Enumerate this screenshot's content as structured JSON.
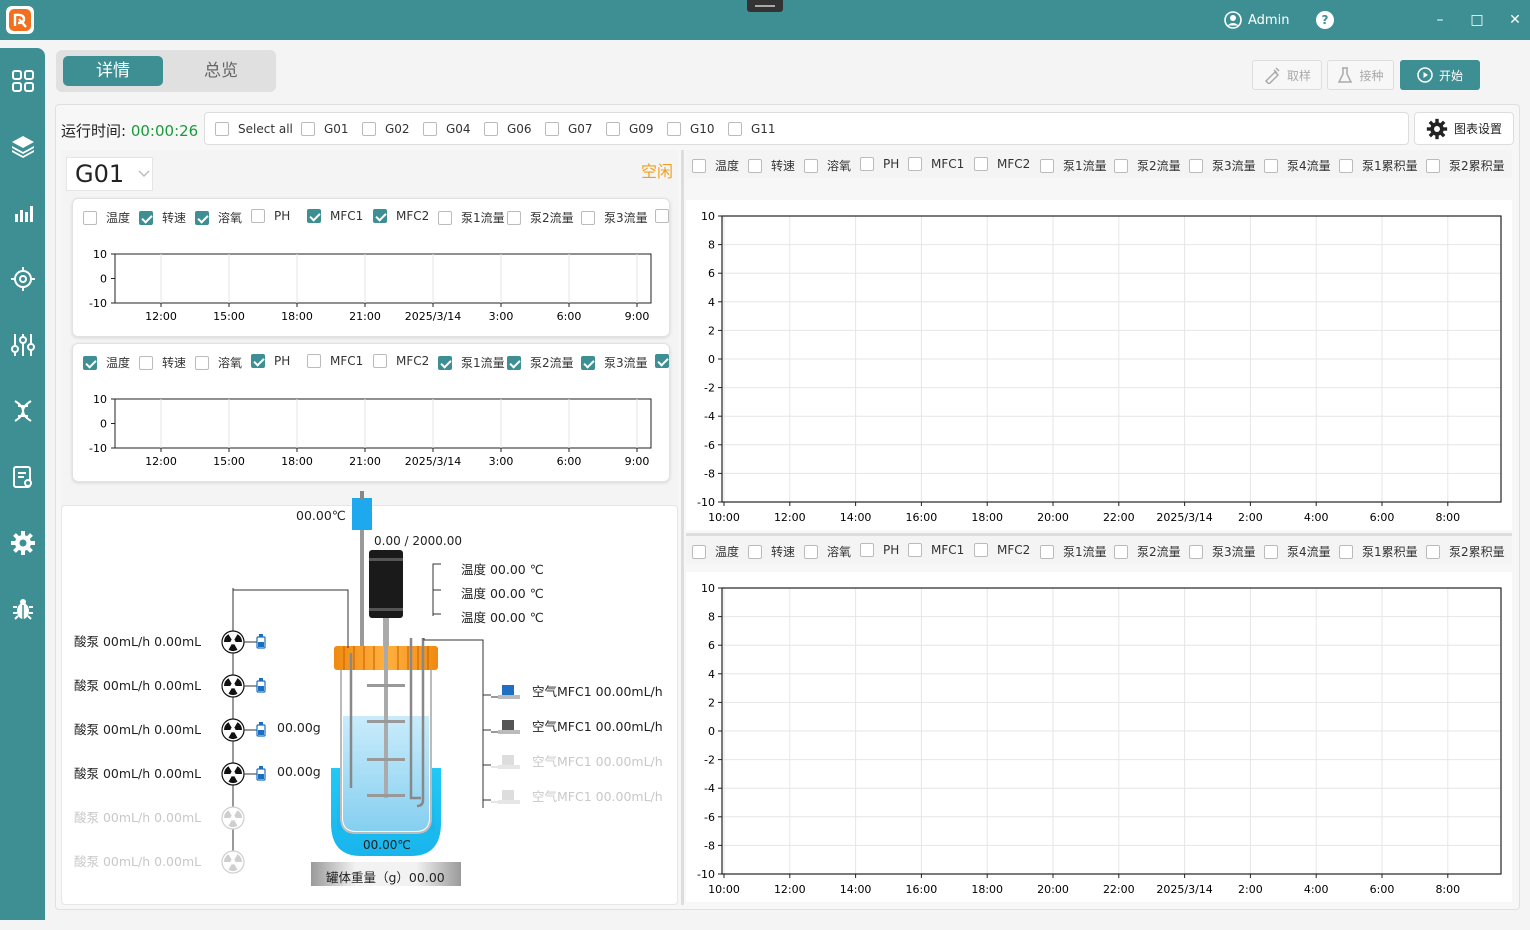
{
  "window": {
    "user": "Admin",
    "help": "?",
    "minimize": "–",
    "maximize": "□",
    "close": "✕"
  },
  "tabs": {
    "detail": "详情",
    "overview": "总览"
  },
  "actions": {
    "sample": "取样",
    "inoculate": "接种",
    "start": "开始"
  },
  "run": {
    "label": "运行时间:",
    "time": "00:00:26"
  },
  "groups": [
    "Select all",
    "G01",
    "G02",
    "G04",
    "G06",
    "G07",
    "G09",
    "G10",
    "G11"
  ],
  "chart_settings": "图表设置",
  "device": {
    "selected": "G01",
    "status": "空闲"
  },
  "left_charts": [
    {
      "params": [
        [
          "温度",
          false
        ],
        [
          "转速",
          true
        ],
        [
          "溶氧",
          true
        ],
        [
          "PH",
          false
        ],
        [
          "MFC1",
          true
        ],
        [
          "MFC2",
          true
        ],
        [
          "泵1流量",
          false
        ],
        [
          "泵2流量",
          false
        ],
        [
          "泵3流量",
          false
        ]
      ],
      "y_ticks": [
        "10",
        "0",
        "-10"
      ],
      "x_ticks": [
        "12:00",
        "15:00",
        "18:00",
        "21:00",
        "2025/3/14",
        "3:00",
        "6:00",
        "9:00"
      ]
    },
    {
      "params": [
        [
          "温度",
          true
        ],
        [
          "转速",
          false
        ],
        [
          "溶氧",
          false
        ],
        [
          "PH",
          true
        ],
        [
          "MFC1",
          false
        ],
        [
          "MFC2",
          false
        ],
        [
          "泵1流量",
          true
        ],
        [
          "泵2流量",
          true
        ],
        [
          "泵3流量",
          true
        ]
      ],
      "y_ticks": [
        "10",
        "0",
        "-10"
      ],
      "x_ticks": [
        "12:00",
        "15:00",
        "18:00",
        "21:00",
        "2025/3/14",
        "3:00",
        "6:00",
        "9:00"
      ]
    }
  ],
  "right_params": [
    "温度",
    "转速",
    "溶氧",
    "PH",
    "MFC1",
    "MFC2",
    "泵1流量",
    "泵2流量",
    "泵3流量",
    "泵4流量",
    "泵1累积量",
    "泵2累积量"
  ],
  "big_chart": {
    "y_ticks": [
      "10",
      "8",
      "6",
      "4",
      "2",
      "0",
      "-2",
      "-4",
      "-6",
      "-8",
      "-10"
    ],
    "x_ticks": [
      "10:00",
      "12:00",
      "14:00",
      "16:00",
      "18:00",
      "20:00",
      "22:00",
      "2025/3/14",
      "2:00",
      "4:00",
      "6:00",
      "8:00"
    ]
  },
  "reactor": {
    "top_temp": "00.00℃",
    "speed": "0.00 / 2000.00",
    "temps": [
      "温度  00.00 ℃",
      "温度  00.00 ℃",
      "温度  00.00 ℃"
    ],
    "pumps": [
      {
        "label": "酸泵 00mL/h  0.00mL",
        "weight": "",
        "dim": false
      },
      {
        "label": "酸泵 00mL/h  0.00mL",
        "weight": "",
        "dim": false
      },
      {
        "label": "酸泵 00mL/h  0.00mL",
        "weight": "00.00g",
        "dim": false
      },
      {
        "label": "酸泵 00mL/h  0.00mL",
        "weight": "00.00g",
        "dim": false
      },
      {
        "label": "酸泵 00mL/h  0.00mL",
        "weight": "",
        "dim": true
      },
      {
        "label": "酸泵 00mL/h  0.00mL",
        "weight": "",
        "dim": true
      }
    ],
    "mfcs": [
      {
        "label": "空气MFC1  00.00mL/h",
        "dim": false,
        "color": "#1f6fc2"
      },
      {
        "label": "空气MFC1  00.00mL/h",
        "dim": false,
        "color": "#555555"
      },
      {
        "label": "空气MFC1  00.00mL/h",
        "dim": true,
        "color": "#dddddd"
      },
      {
        "label": "空气MFC1  00.00mL/h",
        "dim": true,
        "color": "#dddddd"
      }
    ],
    "jacket_temp": "00.00℃",
    "weight_label": "罐体重量（g）00.00"
  },
  "colors": {
    "teal": "#3e8f94",
    "green": "#1a9a3c",
    "orange": "#f0a020"
  }
}
